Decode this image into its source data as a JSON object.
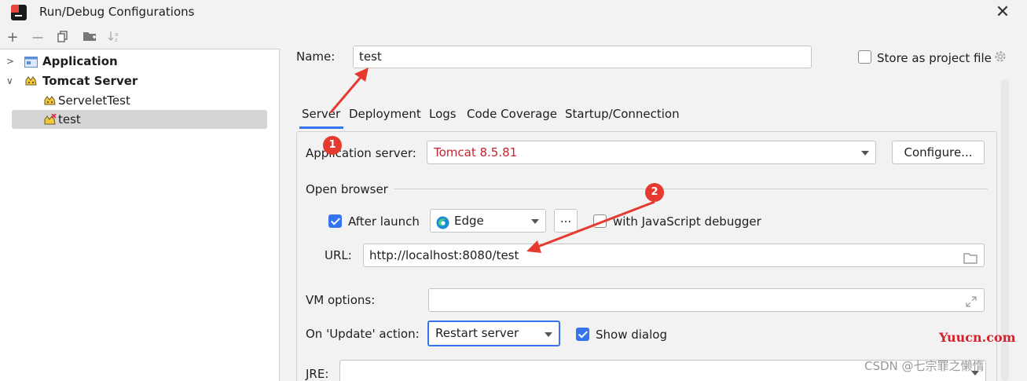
{
  "window": {
    "title": "Run/Debug Configurations",
    "close_glyph": "✕"
  },
  "toolbar": {
    "add": "+",
    "remove": "—",
    "copy_icon": "copy-icon",
    "folder_icon": "new-folder-icon",
    "sort_icon": "sort-icon"
  },
  "tree": {
    "items": [
      {
        "label": "Application",
        "bold": true,
        "icon": "application-icon"
      },
      {
        "label": "Tomcat Server",
        "bold": true,
        "icon": "tomcat-icon"
      },
      {
        "label": "ServeletTest",
        "icon": "tomcat-icon"
      },
      {
        "label": "test",
        "icon": "tomcat-error-icon",
        "selected": true
      }
    ]
  },
  "form": {
    "name_label": "Name:",
    "name_value": "test",
    "store_label": "Store as project file",
    "tabs": [
      "Server",
      "Deployment",
      "Logs",
      "Code Coverage",
      "Startup/Connection"
    ],
    "active_tab": "Server",
    "app_server_label": "Application server:",
    "app_server_value": "Tomcat 8.5.81",
    "configure_label": "Configure...",
    "open_browser_label": "Open browser",
    "after_launch_label": "After launch",
    "browser_value": "Edge",
    "ellipsis_label": "...",
    "js_debugger_label": "with JavaScript debugger",
    "url_label": "URL:",
    "url_value": "http://localhost:8080/test",
    "vm_options_label": "VM options:",
    "vm_options_value": "",
    "update_action_label": "On 'Update' action:",
    "update_action_value": "Restart server",
    "show_dialog_label": "Show dialog",
    "jre_label": "JRE:"
  },
  "annotations": {
    "badge1": "1",
    "badge2": "2"
  },
  "watermark": {
    "site": "Yuucn.com",
    "author": "CSDN @七宗罪之懒惰"
  },
  "colors": {
    "accent": "#3574f0",
    "error_red": "#c7222d",
    "annotation_red": "#e63a30"
  }
}
